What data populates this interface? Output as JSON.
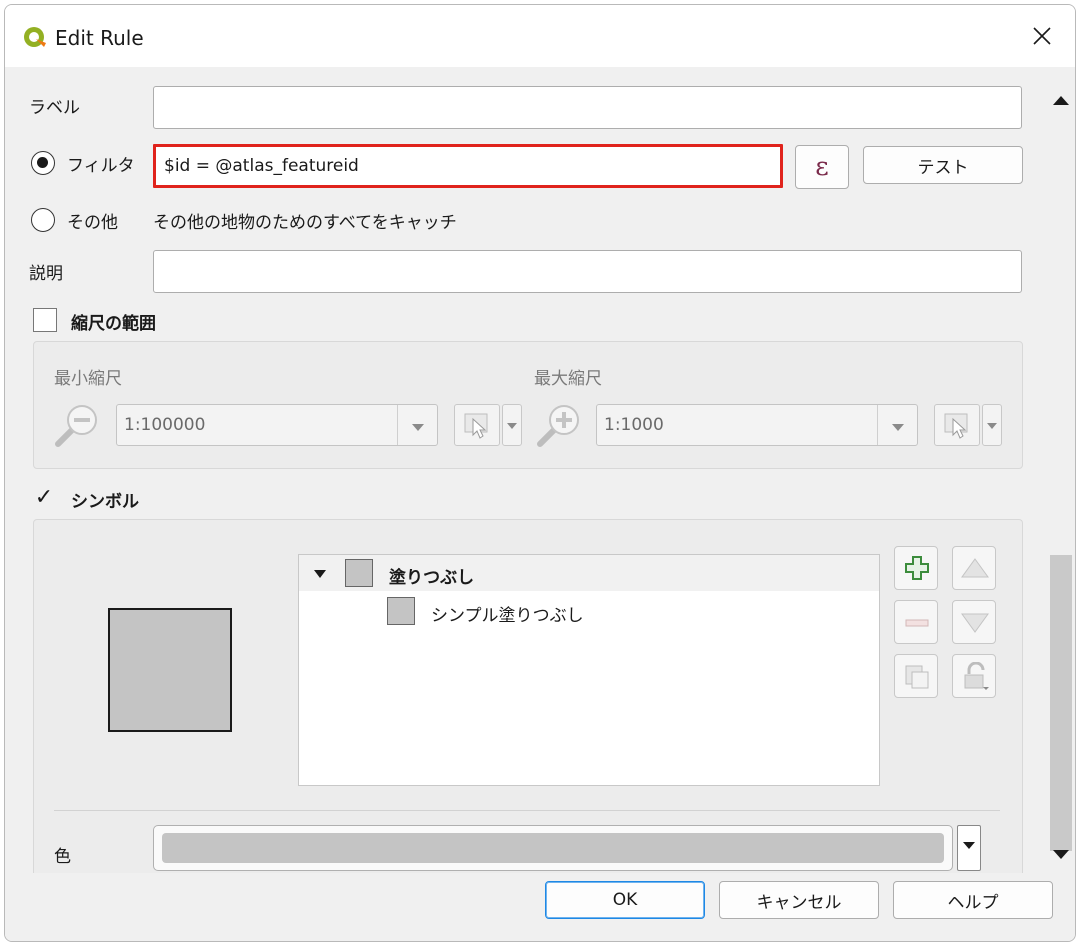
{
  "window": {
    "title": "Edit Rule"
  },
  "form": {
    "label_caption": "ラベル",
    "label_value": "",
    "filter_caption": "フィルタ",
    "filter_value": "$id =  @atlas_featureid",
    "expression_button": "ε",
    "test_button": "テスト",
    "else_caption": "その他",
    "else_description": "その他の地物のためのすべてをキャッチ",
    "description_caption": "説明",
    "description_value": ""
  },
  "scale_range": {
    "title": "縮尺の範囲",
    "checked": false,
    "min_label": "最小縮尺",
    "min_value": "1:100000",
    "max_label": "最大縮尺",
    "max_value": "1:1000"
  },
  "symbol": {
    "title": "シンボル",
    "checked": true,
    "checkmark": "✓",
    "layers": [
      {
        "label": "塗りつぶし"
      },
      {
        "label": "シンプル塗りつぶし"
      }
    ],
    "fill_color": "#c4c4c4",
    "color_label": "色"
  },
  "buttons": {
    "ok": "OK",
    "cancel": "キャンセル",
    "help": "ヘルプ"
  },
  "colors": {
    "filter_highlight": "#e0231c",
    "ok_border": "#1e88e5",
    "add_icon_green": "#3c8c3c"
  }
}
